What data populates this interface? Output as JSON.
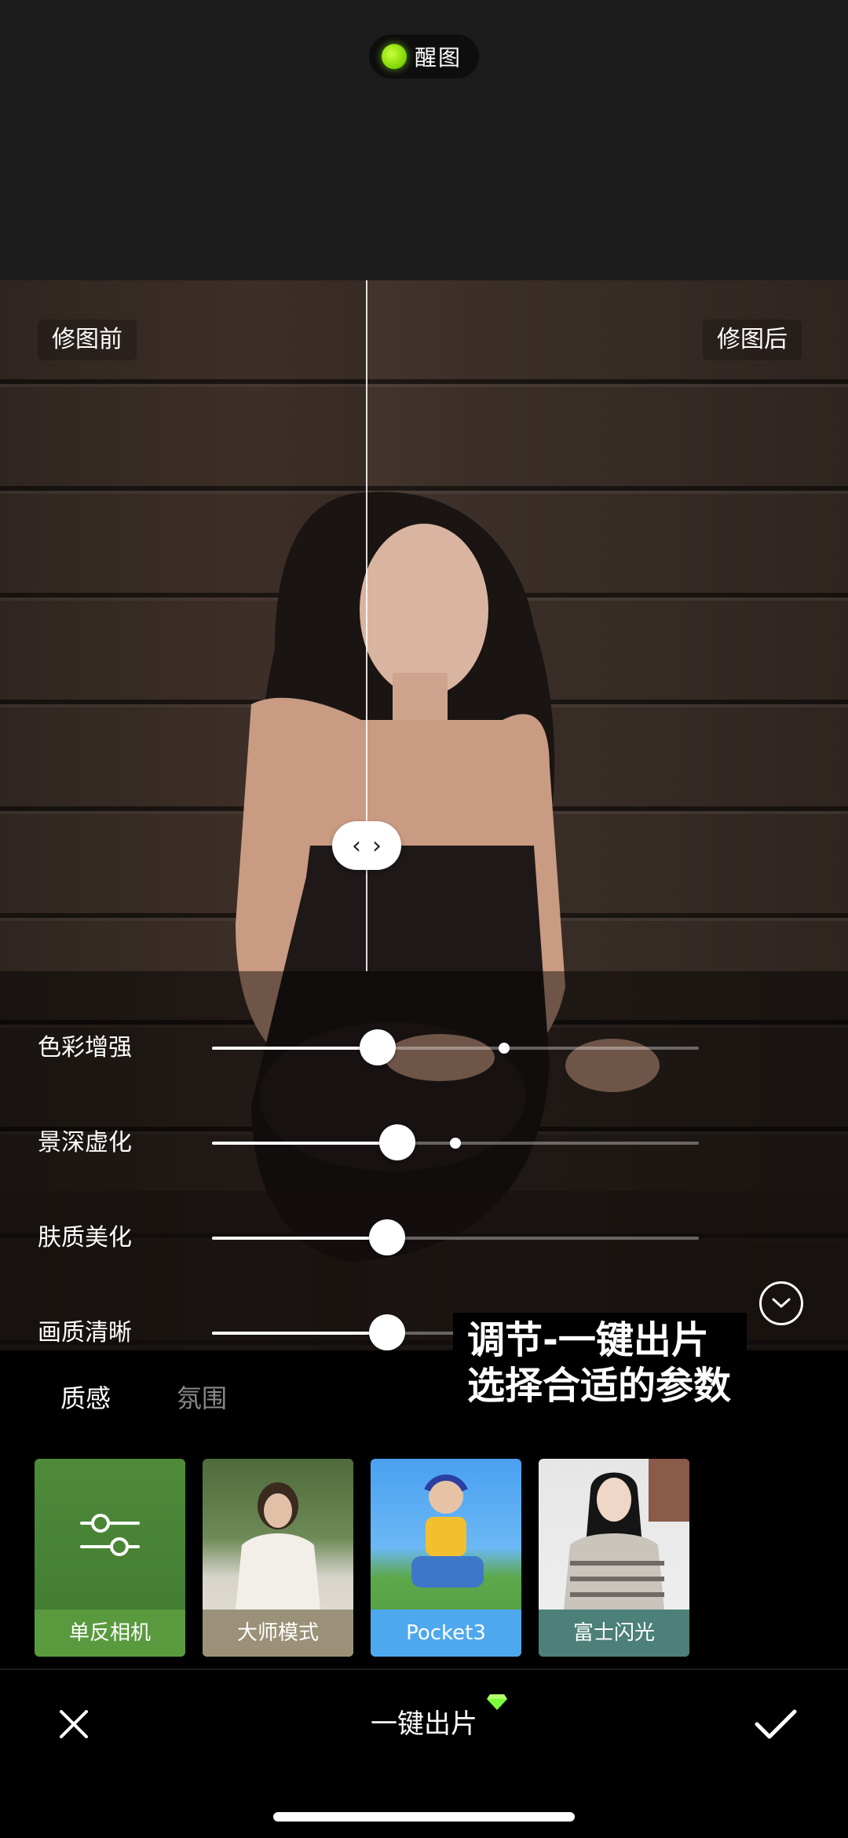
{
  "header": {
    "badge_label": "醒图"
  },
  "compare": {
    "before_label": "修图前",
    "after_label": "修图后",
    "handle_left": "‹",
    "handle_right": "›"
  },
  "sliders": [
    {
      "label": "色彩增强",
      "value": 0.34,
      "reference": 0.6
    },
    {
      "label": "景深虚化",
      "value": 0.38,
      "reference": 0.5
    },
    {
      "label": "肤质美化",
      "value": 0.36,
      "reference": null
    },
    {
      "label": "画质清晰",
      "value": 0.36,
      "reference": 0.8
    }
  ],
  "caption": {
    "line1": "调节-一键出片",
    "line2": "选择合适的参数"
  },
  "tabs": [
    {
      "label": "质感",
      "active": true
    },
    {
      "label": "氛围",
      "active": false
    }
  ],
  "presets": [
    {
      "label": "单反相机",
      "label_bg": "#5a9a3f",
      "icon": "sliders-icon"
    },
    {
      "label": "大师模式",
      "label_bg": "#9a9178"
    },
    {
      "label": "Pocket3",
      "label_bg": "#4da8ee"
    },
    {
      "label": "富士闪光",
      "label_bg": "#4c8079"
    }
  ],
  "footer": {
    "title": "一键出片",
    "close_icon": "close-icon",
    "confirm_icon": "check-icon",
    "vip_icon": "diamond-icon",
    "accent": "#7cff3a"
  }
}
